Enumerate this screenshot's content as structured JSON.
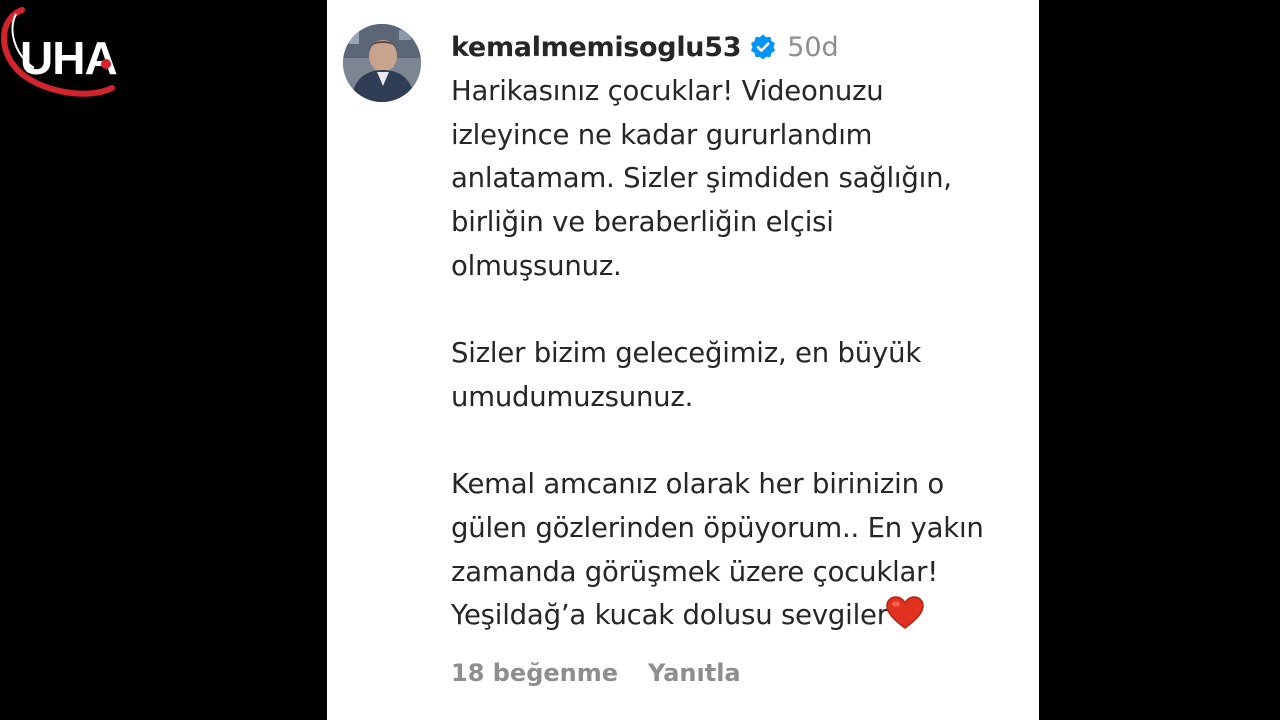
{
  "logo": {
    "text": "UHA",
    "colors": {
      "ring": "#d3232f",
      "text": "#ffffff",
      "accent": "#d3232f"
    }
  },
  "comment": {
    "username": "kemalmemisoglu53",
    "verified_icon": "verified-badge-icon",
    "time": "50d",
    "avatar_icon": "profile-avatar",
    "lines": [
      "Harikasınız çocuklar! Videonuzu",
      "izleyince ne kadar gururlandım",
      "anlatamam. Sizler şimdiden sağlığın,",
      "birliğin ve beraberliğin elçisi",
      "olmuşsunuz.",
      "",
      "Sizler bizim geleceğimiz, en büyük",
      "umudumuzsunuz.",
      "",
      "Kemal amcanız olarak her birinizin o",
      "gülen gözlerinden öpüyorum.. En yakın",
      "zamanda görüşmek üzere çocuklar!",
      "Yeşildağ’a kucak dolusu sevgiler"
    ],
    "end_icon": "red-heart-emoji",
    "likes": "18 beğenme",
    "reply": "Yanıtla"
  },
  "colors": {
    "background": "#000000",
    "panel": "#ffffff",
    "text": "#262626",
    "muted": "#8e8e8e",
    "verified": "#0095f6",
    "heart": "#e0301e"
  }
}
